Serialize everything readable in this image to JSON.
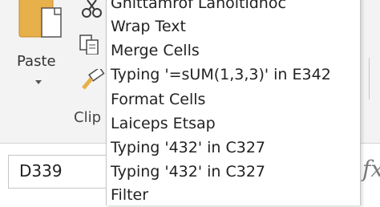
{
  "ribbon": {
    "paste_label": "Paste",
    "group_label": "Clip",
    "icons": [
      "cut-icon",
      "copy-icon",
      "format-painter-icon",
      "clipboard-icon"
    ]
  },
  "undo_list": {
    "items": [
      "Ghittamrof Lanoitidnoc",
      "Wrap Text",
      "Merge Cells",
      "Typing '=sUM(1,3,3)' in E342",
      "Format Cells",
      "Laiceps Etsap",
      "Typing '432' in C327",
      "Typing '432' in C327",
      "Filter"
    ]
  },
  "formula_bar": {
    "name_box": "D339",
    "fx": "fx"
  }
}
